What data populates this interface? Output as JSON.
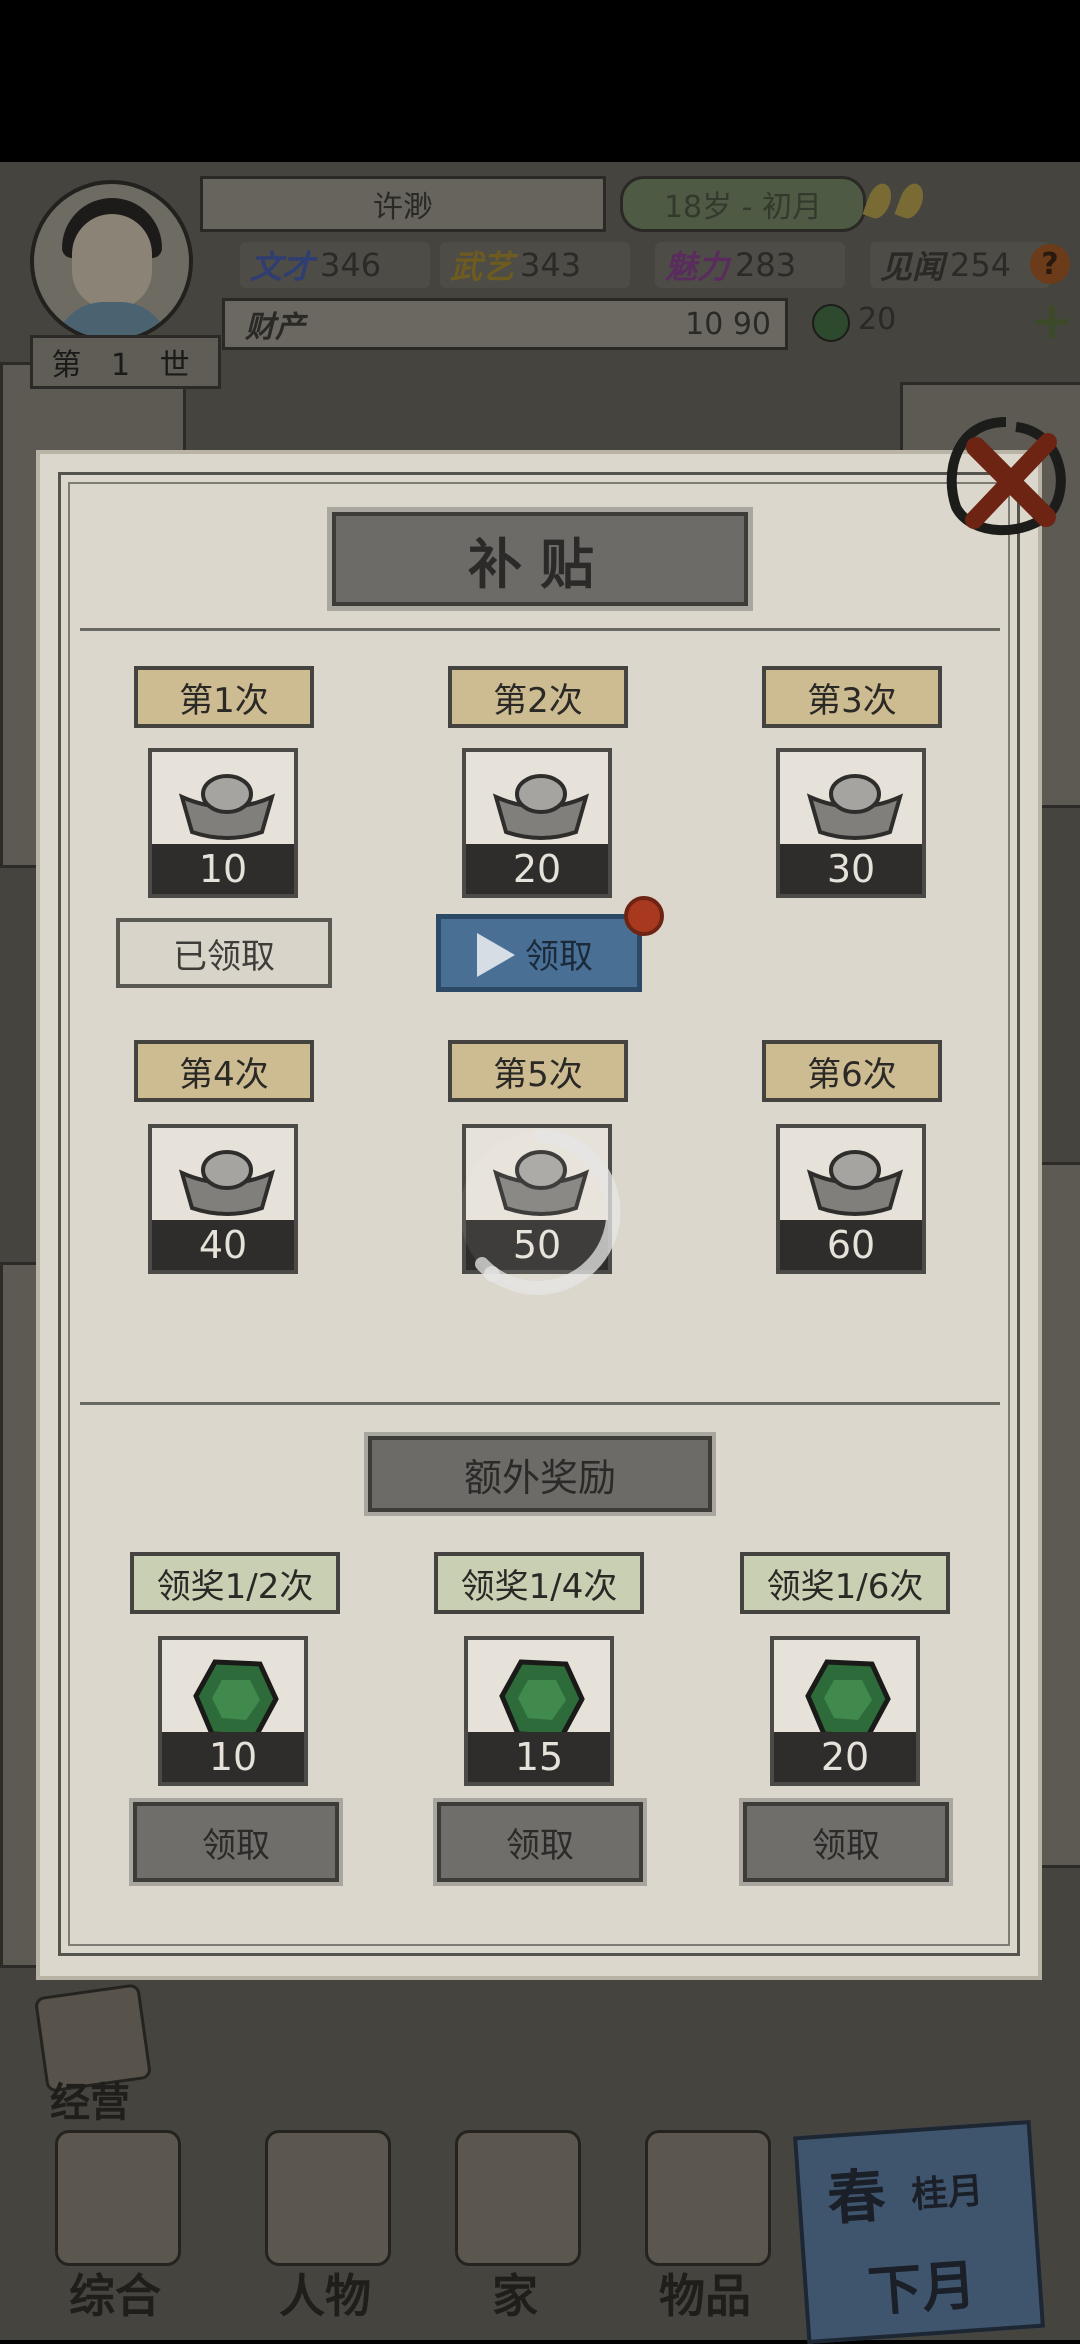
{
  "header": {
    "name": "许渺",
    "age": "18岁 - 初月",
    "generation": "第 1 世",
    "stats": [
      {
        "label": "文才",
        "value": "346"
      },
      {
        "label": "武艺",
        "value": "343"
      },
      {
        "label": "魅力",
        "value": "283"
      },
      {
        "label": "见闻",
        "value": "254"
      }
    ],
    "wealth_label": "财产",
    "wealth_value": "10 90",
    "jade_value": "20"
  },
  "modal": {
    "title": "补贴",
    "rewards": [
      {
        "label": "第1次",
        "amount": "10",
        "status": "已领取"
      },
      {
        "label": "第2次",
        "amount": "20",
        "status": "领取"
      },
      {
        "label": "第3次",
        "amount": "30"
      },
      {
        "label": "第4次",
        "amount": "40"
      },
      {
        "label": "第5次",
        "amount": "50"
      },
      {
        "label": "第6次",
        "amount": "60"
      }
    ],
    "bonus_title": "额外奖励",
    "bonus": [
      {
        "label": "领奖1/2次",
        "amount": "10",
        "button": "领取"
      },
      {
        "label": "领奖1/4次",
        "amount": "15",
        "button": "领取"
      },
      {
        "label": "领奖1/6次",
        "amount": "20",
        "button": "领取"
      }
    ]
  },
  "bottom_nav": {
    "jingying": "经营",
    "items": [
      "综合",
      "人物",
      "家",
      "物品"
    ],
    "season": {
      "season": "春",
      "month": "桂月",
      "next": "下月"
    }
  },
  "icons": {
    "close": "close-x-icon",
    "reward": "silver-ingot-icon",
    "bonus": "jade-gem-icon",
    "play": "play-icon"
  },
  "colors": {
    "active_button": "#4a6f95",
    "notification": "#a8391f"
  }
}
